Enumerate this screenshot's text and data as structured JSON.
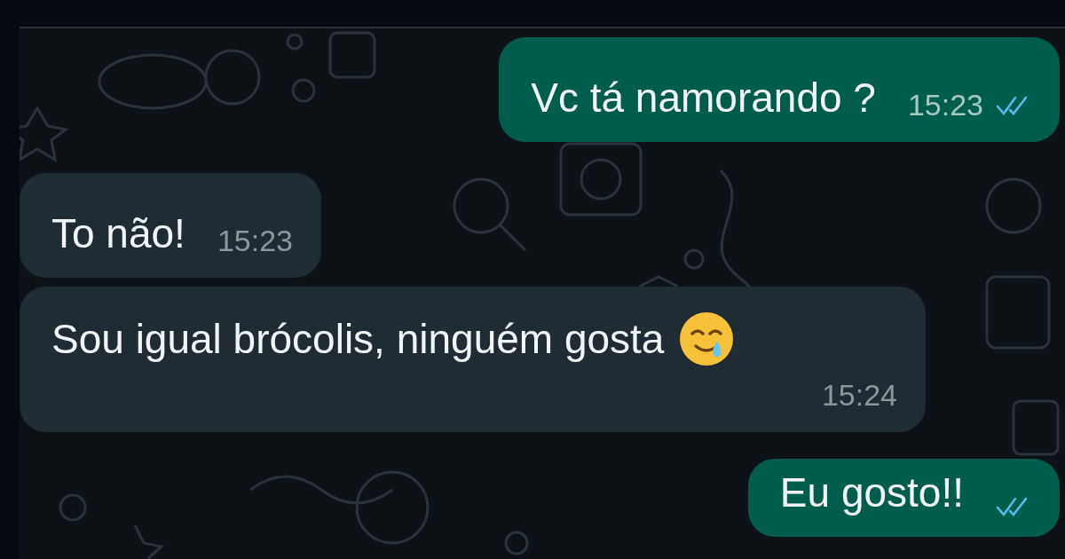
{
  "messages": [
    {
      "kind": "sent",
      "text": "Vc tá namorando ?",
      "time": "15:23",
      "read": true
    },
    {
      "kind": "received",
      "text": "To não!",
      "time": "15:23"
    },
    {
      "kind": "received",
      "text": "Sou igual brócolis, ninguém gosta",
      "emoji": true,
      "time": "15:24"
    },
    {
      "kind": "sent",
      "text": "Eu gosto!!",
      "read": true
    }
  ]
}
